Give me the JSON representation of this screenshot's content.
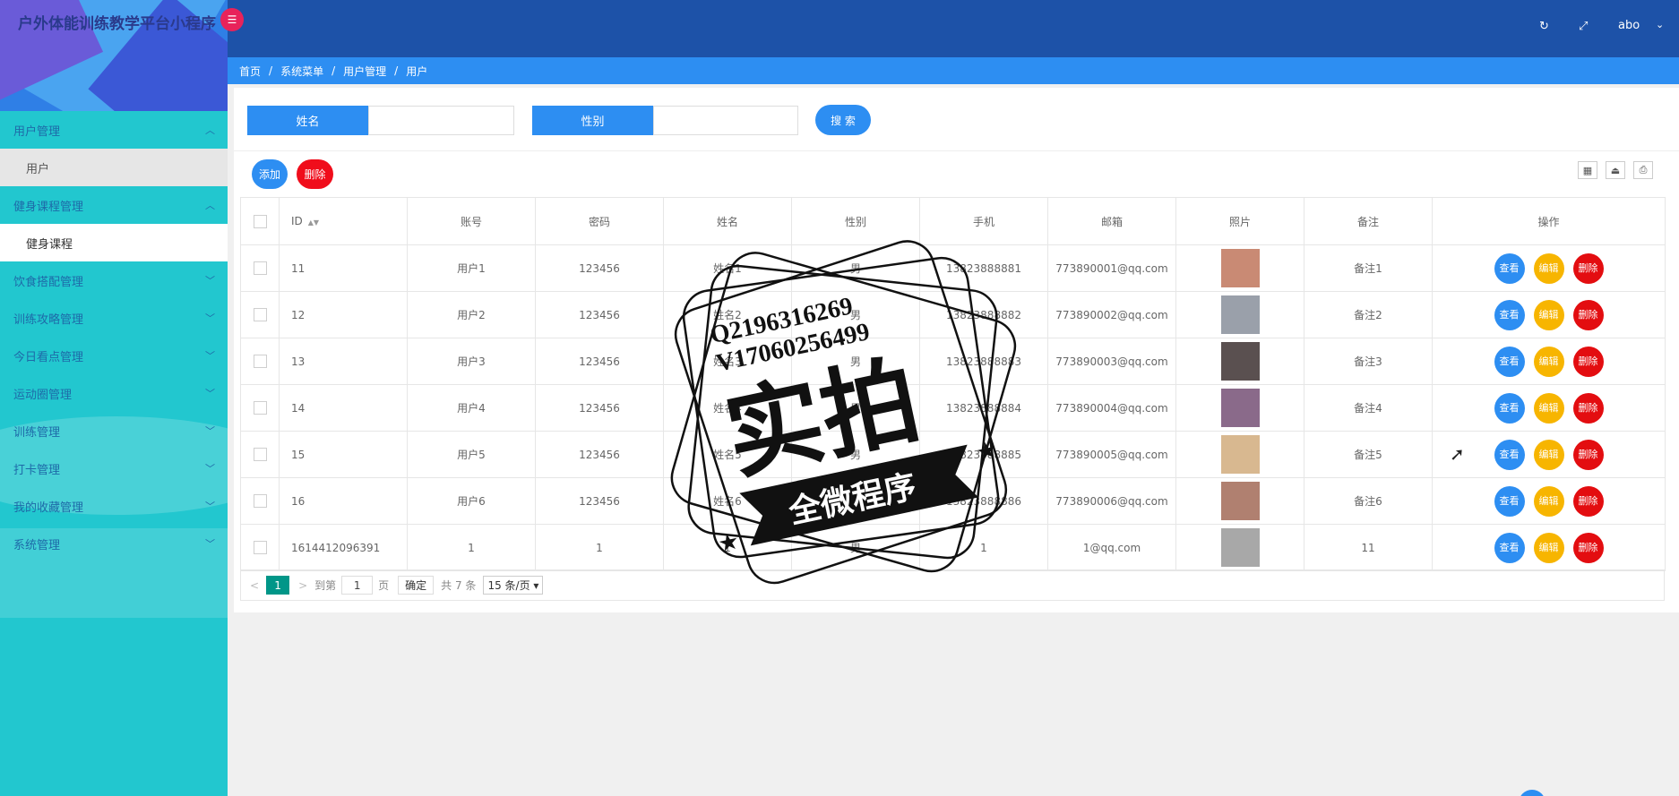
{
  "app": {
    "title": "户外体能训练教学平台小程序",
    "badge": "☰"
  },
  "header": {
    "user": "abo",
    "refresh_icon": "↻",
    "fullscreen_icon": "⤢",
    "chevron": "⌄"
  },
  "breadcrumb": [
    "首页",
    "系统菜单",
    "用户管理",
    "用户"
  ],
  "sidebar": {
    "groups": [
      {
        "label": "用户管理",
        "open": true,
        "items": [
          "用户"
        ]
      },
      {
        "label": "健身课程管理",
        "open": true,
        "items": [
          "健身课程"
        ]
      },
      {
        "label": "饮食搭配管理",
        "open": false,
        "items": []
      },
      {
        "label": "训练攻略管理",
        "open": false,
        "items": []
      },
      {
        "label": "今日看点管理",
        "open": false,
        "items": []
      },
      {
        "label": "运动圈管理",
        "open": false,
        "items": []
      },
      {
        "label": "训练管理",
        "open": false,
        "items": []
      },
      {
        "label": "打卡管理",
        "open": false,
        "items": []
      },
      {
        "label": "我的收藏管理",
        "open": false,
        "items": []
      },
      {
        "label": "系统管理",
        "open": false,
        "items": []
      }
    ]
  },
  "search": {
    "name_label": "姓名",
    "gender_label": "性别",
    "button": "搜 索"
  },
  "actions": {
    "add": "添加",
    "delete": "删除"
  },
  "table": {
    "headers": [
      "ID",
      "账号",
      "密码",
      "姓名",
      "性别",
      "手机",
      "邮箱",
      "照片",
      "备注",
      "操作"
    ],
    "rows": [
      {
        "id": "11",
        "account": "用户1",
        "password": "123456",
        "name": "姓名1",
        "gender": "男",
        "phone": "13823888881",
        "email": "773890001@qq.com",
        "note": "备注1",
        "photo_color": "#c98a74"
      },
      {
        "id": "12",
        "account": "用户2",
        "password": "123456",
        "name": "姓名2",
        "gender": "男",
        "phone": "13823888882",
        "email": "773890002@qq.com",
        "note": "备注2",
        "photo_color": "#9aa0aa"
      },
      {
        "id": "13",
        "account": "用户3",
        "password": "123456",
        "name": "姓名3",
        "gender": "男",
        "phone": "13823888883",
        "email": "773890003@qq.com",
        "note": "备注3",
        "photo_color": "#5a5050"
      },
      {
        "id": "14",
        "account": "用户4",
        "password": "123456",
        "name": "姓名4",
        "gender": "男",
        "phone": "13823888884",
        "email": "773890004@qq.com",
        "note": "备注4",
        "photo_color": "#8a6a8a"
      },
      {
        "id": "15",
        "account": "用户5",
        "password": "123456",
        "name": "姓名5",
        "gender": "男",
        "phone": "13823888885",
        "email": "773890005@qq.com",
        "note": "备注5",
        "photo_color": "#d8b890"
      },
      {
        "id": "16",
        "account": "用户6",
        "password": "123456",
        "name": "姓名6",
        "gender": "男",
        "phone": "13823888886",
        "email": "773890006@qq.com",
        "note": "备注6",
        "photo_color": "#b08070"
      },
      {
        "id": "1614412096391",
        "account": "1",
        "password": "1",
        "name": "1",
        "gender": "男",
        "phone": "1",
        "email": "1@qq.com",
        "note": "11",
        "photo_color": "#a8a8a8"
      }
    ],
    "row_buttons": {
      "view": "查看",
      "edit": "编辑",
      "delete": "删除"
    }
  },
  "pager": {
    "prev": "<",
    "current": "1",
    "next": ">",
    "goto": "到第",
    "page_input": "1",
    "page_unit": "页",
    "confirm": "确定",
    "total": "共 7 条",
    "page_size": "15 条/页"
  },
  "watermark": {
    "line1": "Q2196316269",
    "line2": "V17060256499",
    "main": "实拍",
    "banner": "全微程序"
  },
  "colors": {
    "sidebar": "#22c7cf",
    "header": "#1d52a8",
    "breadcrumb": "#2d8ef2",
    "primary": "#2d8ef2",
    "danger": "#f00d1b",
    "warning": "#f7b500"
  }
}
